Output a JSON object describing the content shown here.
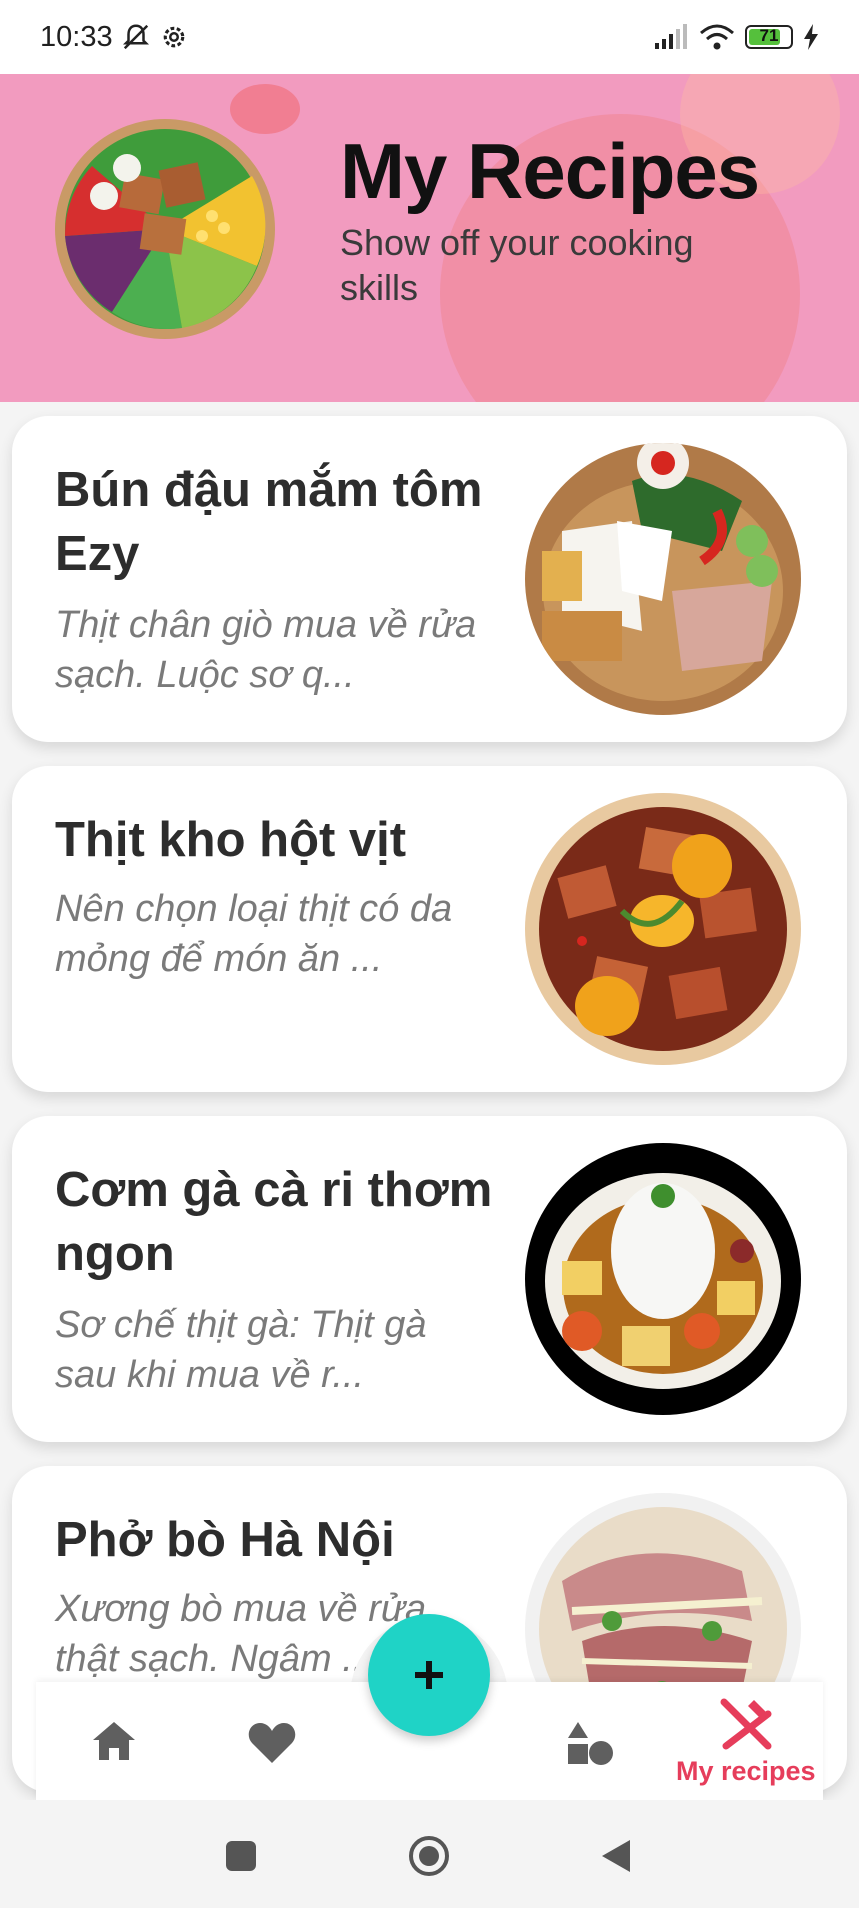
{
  "status_bar": {
    "time": "10:33",
    "icons": [
      "bell-off-icon",
      "settings-gear-icon",
      "signal-icon",
      "wifi-icon",
      "battery-icon",
      "charging-bolt-icon"
    ],
    "battery_level": "71"
  },
  "header": {
    "title": "My Recipes",
    "subtitle": "Show off your cooking skills",
    "background_color": "#f29bbf"
  },
  "recipes": [
    {
      "title": "Bún đậu mắm tôm Ezy",
      "description": "Thịt chân giò mua về rửa sạch. Luộc sơ q..."
    },
    {
      "title": "Thịt kho hột vịt",
      "description": "Nên chọn loại thịt có da mỏng để món ăn ..."
    },
    {
      "title": "Cơm gà cà ri thơm ngon",
      "description": "Sơ chế thịt gà: Thịt gà sau khi mua về r..."
    },
    {
      "title": "Phở bò Hà Nội",
      "description": "Xương bò mua về rửa thật sạch. Ngâm ..."
    }
  ],
  "fab": {
    "icon": "plus-icon",
    "color": "#1fd3c6"
  },
  "bottom_nav": {
    "items": [
      {
        "icon": "home-icon"
      },
      {
        "icon": "heart-icon"
      },
      {
        "icon": "shapes-icon"
      },
      {
        "icon": "fork-knife-icon",
        "label": "My recipes",
        "active": true
      }
    ],
    "active_color": "#e63d5b"
  },
  "system_nav": {
    "icons": [
      "recents-square-icon",
      "home-circle-icon",
      "back-triangle-icon"
    ]
  }
}
